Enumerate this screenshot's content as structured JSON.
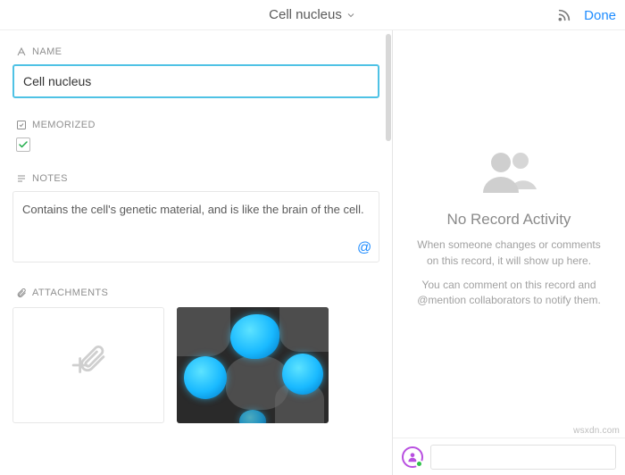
{
  "header": {
    "title": "Cell nucleus",
    "done_label": "Done"
  },
  "fields": {
    "name": {
      "label": "NAME",
      "value": "Cell nucleus"
    },
    "memorized": {
      "label": "MEMORIZED",
      "checked": true
    },
    "notes": {
      "label": "NOTES",
      "value": "Contains the cell's genetic material, and is like the brain of the cell."
    },
    "attachments": {
      "label": "ATTACHMENTS"
    }
  },
  "activity": {
    "title": "No Record Activity",
    "desc1": "When someone changes or comments on this record, it will show up here.",
    "desc2": "You can comment on this record and @mention collaborators to notify them."
  },
  "comment": {
    "placeholder": ""
  },
  "watermark": "wsxdn.com"
}
